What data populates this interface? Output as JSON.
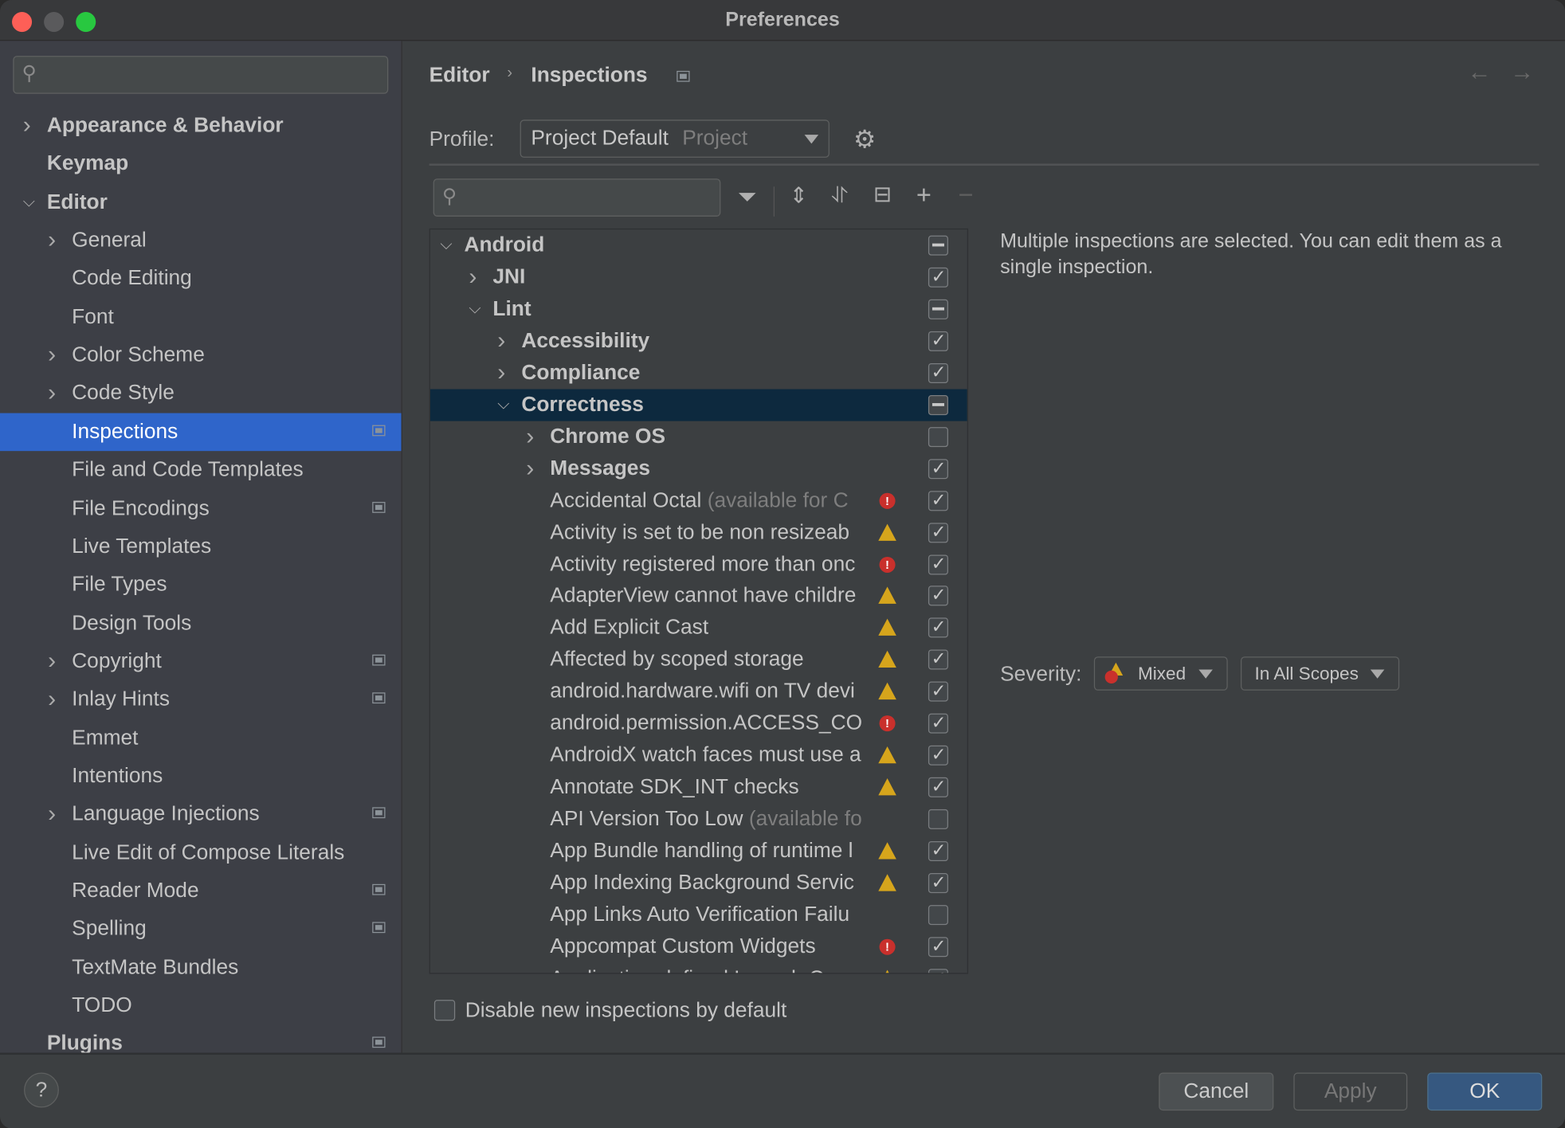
{
  "window": {
    "title": "Preferences",
    "lights": {
      "close": "#fe5f57",
      "minimize": "#5a5a5c",
      "zoom": "#28c840"
    }
  },
  "sidebar": {
    "search": {
      "placeholder": "",
      "value": ""
    },
    "items": [
      {
        "label": "Appearance & Behavior",
        "indent": 0,
        "arrow": "right",
        "bold": true
      },
      {
        "label": "Keymap",
        "indent": 0,
        "bold": true
      },
      {
        "label": "Editor",
        "indent": 0,
        "arrow": "down",
        "bold": true
      },
      {
        "label": "General",
        "indent": 1,
        "arrow": "right"
      },
      {
        "label": "Code Editing",
        "indent": 1
      },
      {
        "label": "Font",
        "indent": 1
      },
      {
        "label": "Color Scheme",
        "indent": 1,
        "arrow": "right"
      },
      {
        "label": "Code Style",
        "indent": 1,
        "arrow": "right"
      },
      {
        "label": "Inspections",
        "indent": 1,
        "selected": true,
        "badge": true
      },
      {
        "label": "File and Code Templates",
        "indent": 1
      },
      {
        "label": "File Encodings",
        "indent": 1,
        "badge": true
      },
      {
        "label": "Live Templates",
        "indent": 1
      },
      {
        "label": "File Types",
        "indent": 1
      },
      {
        "label": "Design Tools",
        "indent": 1
      },
      {
        "label": "Copyright",
        "indent": 1,
        "arrow": "right",
        "badge": true
      },
      {
        "label": "Inlay Hints",
        "indent": 1,
        "arrow": "right",
        "badge": true
      },
      {
        "label": "Emmet",
        "indent": 1
      },
      {
        "label": "Intentions",
        "indent": 1
      },
      {
        "label": "Language Injections",
        "indent": 1,
        "arrow": "right",
        "badge": true
      },
      {
        "label": "Live Edit of Compose Literals",
        "indent": 1
      },
      {
        "label": "Reader Mode",
        "indent": 1,
        "badge": true
      },
      {
        "label": "Spelling",
        "indent": 1,
        "badge": true
      },
      {
        "label": "TextMate Bundles",
        "indent": 1
      },
      {
        "label": "TODO",
        "indent": 1
      },
      {
        "label": "Plugins",
        "indent": 0,
        "bold": true,
        "badge": true
      }
    ]
  },
  "header": {
    "breadcrumb": [
      "Editor",
      "Inspections"
    ],
    "back_icon": "arrow-left-icon",
    "forward_icon": "arrow-right-icon"
  },
  "profile": {
    "label": "Profile:",
    "value": "Project Default",
    "scope": "Project"
  },
  "tree_search": {
    "placeholder": "",
    "value": ""
  },
  "tree": [
    {
      "label": "Android",
      "indent": 0,
      "arrow": "down",
      "bold": true,
      "check": "mixed"
    },
    {
      "label": "JNI",
      "indent": 1,
      "arrow": "right",
      "bold": true,
      "check": "on"
    },
    {
      "label": "Lint",
      "indent": 1,
      "arrow": "down",
      "bold": true,
      "check": "mixed"
    },
    {
      "label": "Accessibility",
      "indent": 2,
      "arrow": "right",
      "bold": true,
      "check": "on"
    },
    {
      "label": "Compliance",
      "indent": 2,
      "arrow": "right",
      "bold": true,
      "check": "on"
    },
    {
      "label": "Correctness",
      "indent": 2,
      "arrow": "down",
      "bold": true,
      "check": "mixed",
      "selected": true
    },
    {
      "label": "Chrome OS",
      "indent": 3,
      "arrow": "right",
      "bold": true,
      "check": "off"
    },
    {
      "label": "Messages",
      "indent": 3,
      "arrow": "right",
      "bold": true,
      "check": "on"
    },
    {
      "label": "Accidental Octal",
      "suffix": "(available for C",
      "indent": 3,
      "severity": "error",
      "check": "on"
    },
    {
      "label": "Activity is set to be non resizeab",
      "indent": 3,
      "severity": "warning",
      "check": "on"
    },
    {
      "label": "Activity registered more than onc",
      "indent": 3,
      "severity": "error",
      "check": "on"
    },
    {
      "label": "AdapterView cannot have childre",
      "indent": 3,
      "severity": "warning",
      "check": "on"
    },
    {
      "label": "Add Explicit Cast",
      "indent": 3,
      "severity": "warning",
      "check": "on"
    },
    {
      "label": "Affected by scoped storage",
      "indent": 3,
      "severity": "warning",
      "check": "on"
    },
    {
      "label": "android.hardware.wifi on TV devi",
      "indent": 3,
      "severity": "warning",
      "check": "on"
    },
    {
      "label": "android.permission.ACCESS_CO",
      "indent": 3,
      "severity": "error",
      "check": "on"
    },
    {
      "label": "AndroidX watch faces must use a",
      "indent": 3,
      "severity": "warning",
      "check": "on"
    },
    {
      "label": "Annotate SDK_INT checks",
      "indent": 3,
      "severity": "warning",
      "check": "on"
    },
    {
      "label": "API Version Too Low",
      "suffix": "(available fo",
      "indent": 3,
      "check": "off"
    },
    {
      "label": "App Bundle handling of runtime l",
      "indent": 3,
      "severity": "warning",
      "check": "on"
    },
    {
      "label": "App Indexing Background Servic",
      "indent": 3,
      "severity": "warning",
      "check": "on"
    },
    {
      "label": "App Links Auto Verification Failu",
      "indent": 3,
      "check": "off"
    },
    {
      "label": "Appcompat Custom Widgets",
      "indent": 3,
      "severity": "error",
      "check": "on"
    },
    {
      "label": "Application-defined Launch C",
      "indent": 3,
      "severity": "warning",
      "check": "on"
    }
  ],
  "description": "Multiple inspections are selected. You can edit them as a single inspection.",
  "severity": {
    "label": "Severity:",
    "value": "Mixed",
    "scope": "In All Scopes"
  },
  "disable_new": {
    "label": "Disable new inspections by default",
    "checked": false
  },
  "footer": {
    "help": "?",
    "cancel": "Cancel",
    "apply": "Apply",
    "ok": "OK"
  }
}
